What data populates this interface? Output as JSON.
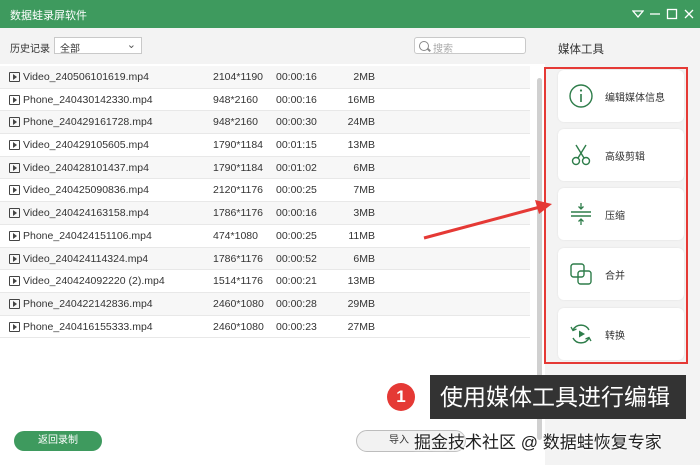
{
  "window": {
    "title": "数据蛙录屏软件"
  },
  "toolbar": {
    "history_label": "历史记录",
    "filter_value": "全部",
    "search_placeholder": "搜索"
  },
  "files": [
    {
      "name": "Video_240506101619.mp4",
      "resolution": "2104*1190",
      "duration": "00:00:16",
      "size": "2MB"
    },
    {
      "name": "Phone_240430142330.mp4",
      "resolution": "948*2160",
      "duration": "00:00:16",
      "size": "16MB"
    },
    {
      "name": "Phone_240429161728.mp4",
      "resolution": "948*2160",
      "duration": "00:00:30",
      "size": "24MB"
    },
    {
      "name": "Video_240429105605.mp4",
      "resolution": "1790*1184",
      "duration": "00:01:15",
      "size": "13MB"
    },
    {
      "name": "Video_240428101437.mp4",
      "resolution": "1790*1184",
      "duration": "00:01:02",
      "size": "6MB"
    },
    {
      "name": "Video_240425090836.mp4",
      "resolution": "2120*1176",
      "duration": "00:00:25",
      "size": "7MB"
    },
    {
      "name": "Video_240424163158.mp4",
      "resolution": "1786*1176",
      "duration": "00:00:16",
      "size": "3MB"
    },
    {
      "name": "Phone_240424151106.mp4",
      "resolution": "474*1080",
      "duration": "00:00:25",
      "size": "11MB"
    },
    {
      "name": "Video_240424114324.mp4",
      "resolution": "1786*1176",
      "duration": "00:00:52",
      "size": "6MB"
    },
    {
      "name": "Video_240424092220 (2).mp4",
      "resolution": "1514*1176",
      "duration": "00:00:21",
      "size": "13MB"
    },
    {
      "name": "Phone_240422142836.mp4",
      "resolution": "2460*1080",
      "duration": "00:00:28",
      "size": "29MB"
    },
    {
      "name": "Phone_240416155333.mp4",
      "resolution": "2460*1080",
      "duration": "00:00:23",
      "size": "27MB"
    }
  ],
  "footer": {
    "back_label": "返回录制",
    "import_label": "导入"
  },
  "media_tools": {
    "title": "媒体工具",
    "items": [
      {
        "label": "编辑媒体信息",
        "icon": "info-icon"
      },
      {
        "label": "高级剪辑",
        "icon": "scissors-icon"
      },
      {
        "label": "压缩",
        "icon": "compress-icon"
      },
      {
        "label": "合并",
        "icon": "merge-icon"
      },
      {
        "label": "转换",
        "icon": "convert-icon"
      }
    ]
  },
  "annotation": {
    "number": "1",
    "text": "使用媒体工具进行编辑"
  },
  "watermark": "掘金技术社区 @ 数据蛙恢复专家",
  "colors": {
    "brand": "#3e9a5e",
    "highlight": "#e53935"
  }
}
